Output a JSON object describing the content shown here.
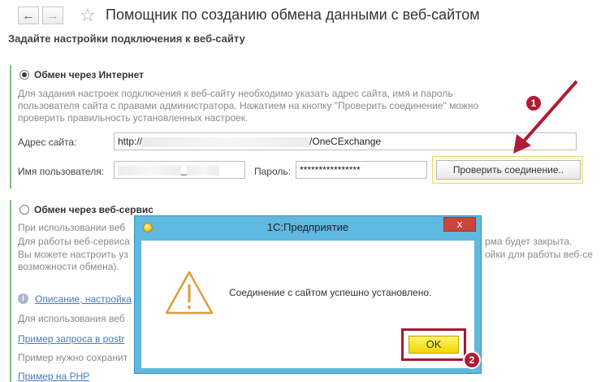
{
  "header": {
    "title": "Помощник по созданию обмена данными с веб-сайтом",
    "subtitle": "Задайте настройки подключения к веб-сайту",
    "back_icon": "arrow-left-icon",
    "forward_icon": "arrow-right-icon",
    "favorite_icon": "star-icon"
  },
  "internet": {
    "label": "Обмен через Интернет",
    "selected": true,
    "help": [
      "Для задания настроек подключения к веб-сайту необходимо указать адрес сайта, имя и пароль",
      "пользователя сайта с правами администратора. Нажатием на кнопку \"Проверить соединение\" можно",
      "проверить правильность установленных настроек."
    ],
    "address_label": "Адрес сайта:",
    "address_prefix": "http://",
    "address_suffix": "/OneCExchange",
    "user_label": "Имя пользователя:",
    "user_value": "_",
    "password_label": "Пароль:",
    "password_value": "****************",
    "check_button": "Проверить соединение.."
  },
  "webservice": {
    "label": "Обмен через веб-сервис",
    "selected": false,
    "help": [
      "При использовании веб",
      "Для работы веб-сервиса",
      "Вы можете настроить уз",
      "возможности обмена)."
    ],
    "help_right": [
      "рма будет закрыта.",
      "ойки для работы веб-се"
    ],
    "info_link": "Описание, настройка",
    "usage_text": "Для использования веб",
    "link1": "Пример запроса в postr",
    "save_text": "Пример нужно сохранит",
    "link2": "Пример на PHP"
  },
  "markers": {
    "m1": "1",
    "m2": "2"
  },
  "dialog": {
    "title": "1С:Предприятие",
    "close_label": "x",
    "message": "Соединение с сайтом успешно установлено.",
    "ok_label": "OK"
  },
  "colors": {
    "accent_green": "#7ec07b",
    "marker": "#b01c35",
    "dialog_frame": "#5fb8e0",
    "ok_button": "#f2d600",
    "link": "#4a7ab8"
  }
}
